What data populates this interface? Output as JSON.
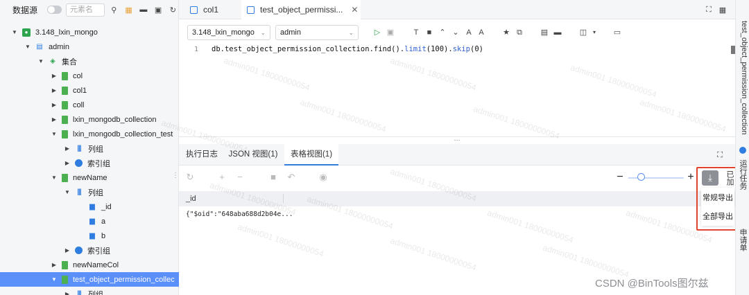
{
  "sidebar": {
    "title": "数据源",
    "search_placeholder": "元素名",
    "tree": [
      {
        "label": "3.148_lxin_mongo",
        "level": 0,
        "icon": "database-icon",
        "expanded": true
      },
      {
        "label": "admin",
        "level": 1,
        "icon": "db-stack-icon",
        "expanded": true
      },
      {
        "label": "集合",
        "level": 2,
        "icon": "layers-icon",
        "expanded": true
      },
      {
        "label": "col",
        "level": 3,
        "icon": "collection-icon",
        "expanded": false
      },
      {
        "label": "col1",
        "level": 3,
        "icon": "collection-icon",
        "expanded": false
      },
      {
        "label": "coll",
        "level": 3,
        "icon": "collection-icon",
        "expanded": false
      },
      {
        "label": "lxin_mongodb_collection",
        "level": 3,
        "icon": "collection-icon",
        "expanded": false
      },
      {
        "label": "lxin_mongodb_collection_test",
        "level": 3,
        "icon": "collection-icon",
        "expanded": true
      },
      {
        "label": "列组",
        "level": 4,
        "icon": "columns-icon",
        "expanded": false
      },
      {
        "label": "索引组",
        "level": 4,
        "icon": "index-icon",
        "expanded": false
      },
      {
        "label": "newName",
        "level": 3,
        "icon": "collection-icon",
        "expanded": true
      },
      {
        "label": "列组",
        "level": 4,
        "icon": "columns-icon",
        "expanded": true
      },
      {
        "label": "_id",
        "level": 5,
        "icon": "field-icon"
      },
      {
        "label": "a",
        "level": 5,
        "icon": "field-icon"
      },
      {
        "label": "b",
        "level": 5,
        "icon": "field-icon"
      },
      {
        "label": "索引组",
        "level": 4,
        "icon": "index-icon",
        "expanded": false
      },
      {
        "label": "newNameCol",
        "level": 3,
        "icon": "collection-icon",
        "expanded": false
      },
      {
        "label": "test_object_permission_collec",
        "level": 3,
        "icon": "collection-icon",
        "expanded": true,
        "selected": true
      },
      {
        "label": "列组",
        "level": 4,
        "icon": "columns-icon",
        "expanded": false
      }
    ]
  },
  "tabs": [
    {
      "label": "col1",
      "active": false
    },
    {
      "label": "test_object_permissi...",
      "active": true,
      "close": "✕"
    }
  ],
  "toolbar": {
    "datasource_select": "3.148_lxin_mongo",
    "database_select": "admin"
  },
  "editor": {
    "line_number": "1",
    "code_prefix": "db.test_object_permission_collection.find().",
    "code_limit": "limit",
    "code_limit_arg": "(100).",
    "code_skip": "skip",
    "code_skip_arg": "(0)"
  },
  "result_tabs": [
    {
      "label": "执行日志",
      "active": false
    },
    {
      "label": "JSON 视图(1)",
      "active": false
    },
    {
      "label": "表格视图(1)",
      "active": true
    }
  ],
  "grid": {
    "columns": [
      "_id"
    ],
    "rows": [
      [
        "{\"$oid\":\"648aba688d2b04e..."
      ]
    ]
  },
  "export_menu": {
    "items": [
      "常规导出",
      "全部导出"
    ]
  },
  "right_rail": {
    "items": [
      "test_object_permission_collection",
      "运行任务",
      "申请单"
    ],
    "peek": "已加"
  },
  "watermark": "admin001 18000000054",
  "credit": "CSDN @BinTools图尔兹",
  "colors": {
    "accent": "#2f7de1",
    "selected_row": "#5b8ff9",
    "highlight_box": "#e0442c"
  }
}
